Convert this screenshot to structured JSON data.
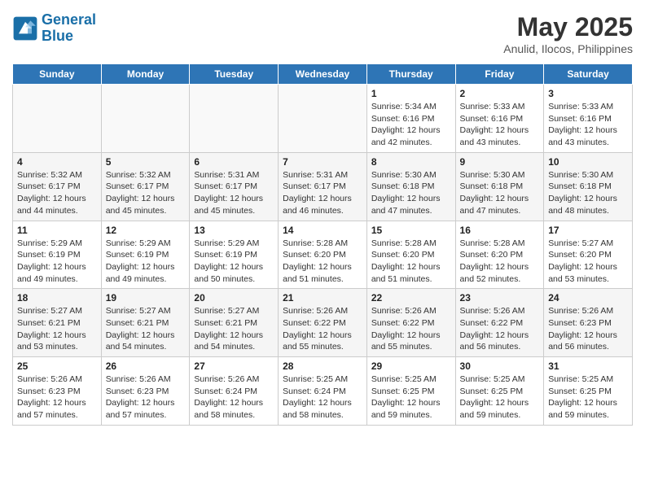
{
  "header": {
    "logo_line1": "General",
    "logo_line2": "Blue",
    "month": "May 2025",
    "location": "Anulid, Ilocos, Philippines"
  },
  "weekdays": [
    "Sunday",
    "Monday",
    "Tuesday",
    "Wednesday",
    "Thursday",
    "Friday",
    "Saturday"
  ],
  "rows": [
    [
      {
        "day": "",
        "info": ""
      },
      {
        "day": "",
        "info": ""
      },
      {
        "day": "",
        "info": ""
      },
      {
        "day": "",
        "info": ""
      },
      {
        "day": "1",
        "info": "Sunrise: 5:34 AM\nSunset: 6:16 PM\nDaylight: 12 hours\nand 42 minutes."
      },
      {
        "day": "2",
        "info": "Sunrise: 5:33 AM\nSunset: 6:16 PM\nDaylight: 12 hours\nand 43 minutes."
      },
      {
        "day": "3",
        "info": "Sunrise: 5:33 AM\nSunset: 6:16 PM\nDaylight: 12 hours\nand 43 minutes."
      }
    ],
    [
      {
        "day": "4",
        "info": "Sunrise: 5:32 AM\nSunset: 6:17 PM\nDaylight: 12 hours\nand 44 minutes."
      },
      {
        "day": "5",
        "info": "Sunrise: 5:32 AM\nSunset: 6:17 PM\nDaylight: 12 hours\nand 45 minutes."
      },
      {
        "day": "6",
        "info": "Sunrise: 5:31 AM\nSunset: 6:17 PM\nDaylight: 12 hours\nand 45 minutes."
      },
      {
        "day": "7",
        "info": "Sunrise: 5:31 AM\nSunset: 6:17 PM\nDaylight: 12 hours\nand 46 minutes."
      },
      {
        "day": "8",
        "info": "Sunrise: 5:30 AM\nSunset: 6:18 PM\nDaylight: 12 hours\nand 47 minutes."
      },
      {
        "day": "9",
        "info": "Sunrise: 5:30 AM\nSunset: 6:18 PM\nDaylight: 12 hours\nand 47 minutes."
      },
      {
        "day": "10",
        "info": "Sunrise: 5:30 AM\nSunset: 6:18 PM\nDaylight: 12 hours\nand 48 minutes."
      }
    ],
    [
      {
        "day": "11",
        "info": "Sunrise: 5:29 AM\nSunset: 6:19 PM\nDaylight: 12 hours\nand 49 minutes."
      },
      {
        "day": "12",
        "info": "Sunrise: 5:29 AM\nSunset: 6:19 PM\nDaylight: 12 hours\nand 49 minutes."
      },
      {
        "day": "13",
        "info": "Sunrise: 5:29 AM\nSunset: 6:19 PM\nDaylight: 12 hours\nand 50 minutes."
      },
      {
        "day": "14",
        "info": "Sunrise: 5:28 AM\nSunset: 6:20 PM\nDaylight: 12 hours\nand 51 minutes."
      },
      {
        "day": "15",
        "info": "Sunrise: 5:28 AM\nSunset: 6:20 PM\nDaylight: 12 hours\nand 51 minutes."
      },
      {
        "day": "16",
        "info": "Sunrise: 5:28 AM\nSunset: 6:20 PM\nDaylight: 12 hours\nand 52 minutes."
      },
      {
        "day": "17",
        "info": "Sunrise: 5:27 AM\nSunset: 6:20 PM\nDaylight: 12 hours\nand 53 minutes."
      }
    ],
    [
      {
        "day": "18",
        "info": "Sunrise: 5:27 AM\nSunset: 6:21 PM\nDaylight: 12 hours\nand 53 minutes."
      },
      {
        "day": "19",
        "info": "Sunrise: 5:27 AM\nSunset: 6:21 PM\nDaylight: 12 hours\nand 54 minutes."
      },
      {
        "day": "20",
        "info": "Sunrise: 5:27 AM\nSunset: 6:21 PM\nDaylight: 12 hours\nand 54 minutes."
      },
      {
        "day": "21",
        "info": "Sunrise: 5:26 AM\nSunset: 6:22 PM\nDaylight: 12 hours\nand 55 minutes."
      },
      {
        "day": "22",
        "info": "Sunrise: 5:26 AM\nSunset: 6:22 PM\nDaylight: 12 hours\nand 55 minutes."
      },
      {
        "day": "23",
        "info": "Sunrise: 5:26 AM\nSunset: 6:22 PM\nDaylight: 12 hours\nand 56 minutes."
      },
      {
        "day": "24",
        "info": "Sunrise: 5:26 AM\nSunset: 6:23 PM\nDaylight: 12 hours\nand 56 minutes."
      }
    ],
    [
      {
        "day": "25",
        "info": "Sunrise: 5:26 AM\nSunset: 6:23 PM\nDaylight: 12 hours\nand 57 minutes."
      },
      {
        "day": "26",
        "info": "Sunrise: 5:26 AM\nSunset: 6:23 PM\nDaylight: 12 hours\nand 57 minutes."
      },
      {
        "day": "27",
        "info": "Sunrise: 5:26 AM\nSunset: 6:24 PM\nDaylight: 12 hours\nand 58 minutes."
      },
      {
        "day": "28",
        "info": "Sunrise: 5:25 AM\nSunset: 6:24 PM\nDaylight: 12 hours\nand 58 minutes."
      },
      {
        "day": "29",
        "info": "Sunrise: 5:25 AM\nSunset: 6:25 PM\nDaylight: 12 hours\nand 59 minutes."
      },
      {
        "day": "30",
        "info": "Sunrise: 5:25 AM\nSunset: 6:25 PM\nDaylight: 12 hours\nand 59 minutes."
      },
      {
        "day": "31",
        "info": "Sunrise: 5:25 AM\nSunset: 6:25 PM\nDaylight: 12 hours\nand 59 minutes."
      }
    ]
  ]
}
